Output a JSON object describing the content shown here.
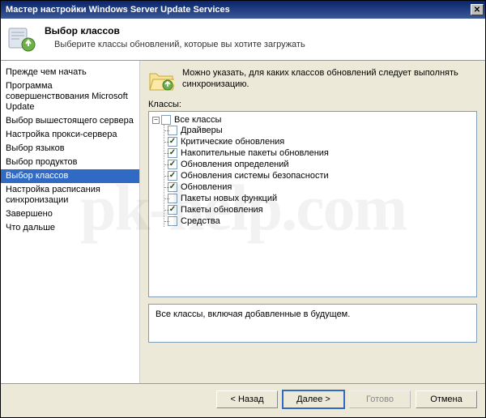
{
  "window": {
    "title": "Мастер настройки Windows Server Update Services"
  },
  "header": {
    "title": "Выбор классов",
    "subtitle": "Выберите классы обновлений, которые вы хотите загружать"
  },
  "sidebar": {
    "items": [
      {
        "label": "Прежде чем начать",
        "selected": false
      },
      {
        "label": "Программа совершенствования Microsoft Update",
        "selected": false
      },
      {
        "label": "Выбор вышестоящего сервера",
        "selected": false
      },
      {
        "label": "Настройка прокси-сервера",
        "selected": false
      },
      {
        "label": "Выбор языков",
        "selected": false
      },
      {
        "label": "Выбор продуктов",
        "selected": false
      },
      {
        "label": "Выбор классов",
        "selected": true
      },
      {
        "label": "Настройка расписания синхронизации",
        "selected": false
      },
      {
        "label": "Завершено",
        "selected": false
      },
      {
        "label": "Что дальше",
        "selected": false
      }
    ]
  },
  "main": {
    "instruction": "Можно указать, для каких классов обновлений следует выполнять синхронизацию.",
    "classes_label": "Классы:",
    "root": {
      "label": "Все классы",
      "checked": false
    },
    "classes": [
      {
        "label": "Драйверы",
        "checked": false
      },
      {
        "label": "Критические обновления",
        "checked": true
      },
      {
        "label": "Накопительные пакеты обновления",
        "checked": true
      },
      {
        "label": "Обновления определений",
        "checked": true
      },
      {
        "label": "Обновления системы безопасности",
        "checked": true
      },
      {
        "label": "Обновления",
        "checked": true
      },
      {
        "label": "Пакеты новых функций",
        "checked": false
      },
      {
        "label": "Пакеты обновления",
        "checked": true
      },
      {
        "label": "Средства",
        "checked": false
      }
    ],
    "description": "Все классы, включая добавленные в будущем."
  },
  "footer": {
    "back": "< Назад",
    "next": "Далее >",
    "finish": "Готово",
    "cancel": "Отмена"
  },
  "watermark": "pk-help.com"
}
